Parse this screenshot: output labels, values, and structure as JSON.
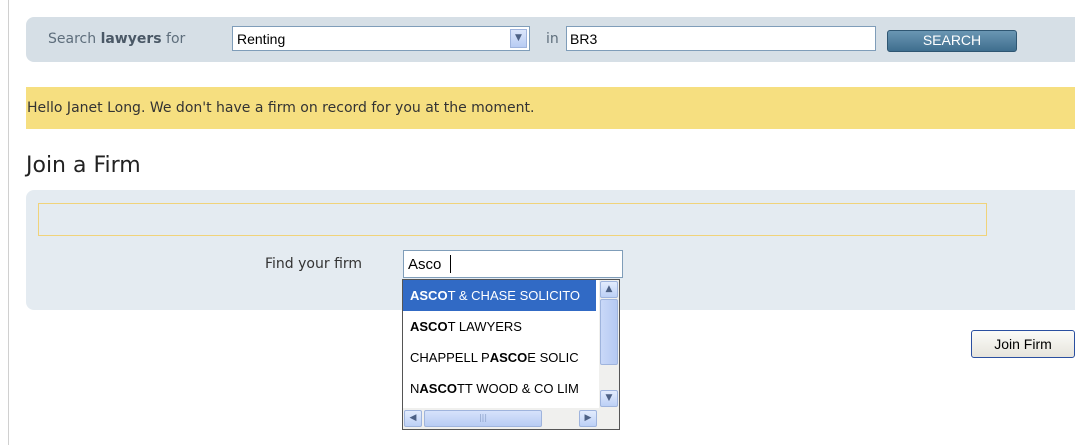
{
  "search": {
    "label_prefix": "Search ",
    "label_bold": "lawyers",
    "label_suffix": " for",
    "category_value": "Renting",
    "in_label": "in",
    "location_value": "BR3",
    "button_label": "SEARCH"
  },
  "notice": {
    "text": "Hello Janet Long. We don't have a firm on record for you at the moment."
  },
  "page": {
    "title": "Join a Firm"
  },
  "join_form": {
    "find_label": "Find your firm",
    "firm_value": "Asco",
    "join_button_label": "Join Firm"
  },
  "autocomplete": {
    "options": [
      {
        "pre": "",
        "match": "ASCO",
        "post": "T & CHASE SOLICITO",
        "selected": true
      },
      {
        "pre": "",
        "match": "ASCO",
        "post": "T LAWYERS",
        "selected": false
      },
      {
        "pre": "CHAPPELL P",
        "match": "ASCO",
        "post": "E SOLIC",
        "selected": false
      },
      {
        "pre": "N",
        "match": "ASCO",
        "post": "TT WOOD & CO LIM",
        "selected": false
      }
    ]
  },
  "colors": {
    "notice_bg": "#f6df80",
    "panel_bg": "#e4ebf1",
    "selected_bg": "#316ac5",
    "search_button": "#4a7a9a"
  },
  "icons": {
    "select_arrow": "chevron-down-icon",
    "scroll_up": "arrow-up-icon",
    "scroll_down": "arrow-down-icon",
    "scroll_left": "arrow-left-icon",
    "scroll_right": "arrow-right-icon"
  }
}
